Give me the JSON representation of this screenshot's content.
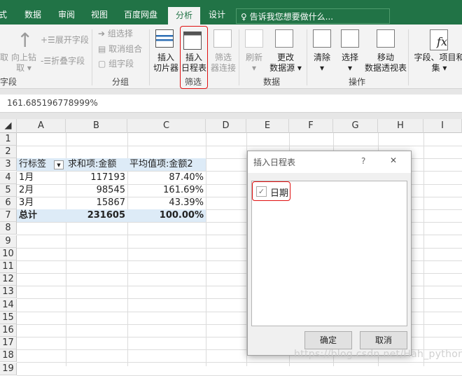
{
  "tabs": [
    {
      "label": "式"
    },
    {
      "label": "数据"
    },
    {
      "label": "审阅"
    },
    {
      "label": "视图"
    },
    {
      "label": "百度网盘"
    },
    {
      "label": "分析"
    },
    {
      "label": "设计"
    }
  ],
  "tell_me": "告诉我您想要做什么...",
  "ribbon": {
    "drill_up_1": "取",
    "drill_up_label": "向上钻",
    "drill_up_label2": "取 ▾",
    "expand": "展开字段",
    "collapse": "折叠字段",
    "group_active_field": "字段",
    "group_selection": "组选择",
    "ungroup": "取消组合",
    "group_field": "组字段",
    "group_group": "分组",
    "insert_slicer": "插入",
    "insert_slicer2": "切片器",
    "insert_timeline": "插入",
    "insert_timeline2": "日程表",
    "filter_conn": "筛选",
    "filter_conn2": "器连接",
    "group_filter": "筛选",
    "refresh": "刷新",
    "refresh2": "▾",
    "change_source": "更改",
    "change_source2": "数据源 ▾",
    "group_data": "数据",
    "clear": "清除",
    "clear2": "▾",
    "select": "选择",
    "select2": "▾",
    "move": "移动",
    "move2": "数据透视表",
    "group_actions": "操作",
    "fields": "字段、项目和",
    "fields2": "集 ▾"
  },
  "formula_value": "161.685196778999%",
  "columns": [
    "A",
    "B",
    "C",
    "D",
    "E",
    "F",
    "G",
    "H",
    "I"
  ],
  "rows": [
    "1",
    "2",
    "3",
    "4",
    "5",
    "6",
    "7",
    "8",
    "9",
    "10",
    "11",
    "12",
    "13",
    "14",
    "15",
    "16",
    "17",
    "18",
    "19"
  ],
  "pivot": {
    "header": [
      "行标签",
      "求和项:金额",
      "平均值项:金额2"
    ],
    "data": [
      [
        "1月",
        "117193",
        "87.40%"
      ],
      [
        "2月",
        "98545",
        "161.69%"
      ],
      [
        "3月",
        "15867",
        "43.39%"
      ]
    ],
    "total": [
      "总计",
      "231605",
      "100.00%"
    ]
  },
  "dialog": {
    "title": "插入日程表",
    "help": "?",
    "close": "✕",
    "field": "日期",
    "checked": true,
    "ok": "确定",
    "cancel": "取消"
  },
  "watermark": "https://blog.csdn.net/Hah_python",
  "colors": {
    "excel_green": "#217346",
    "pivot_band": "#ddebf7",
    "highlight": "#e01010"
  }
}
